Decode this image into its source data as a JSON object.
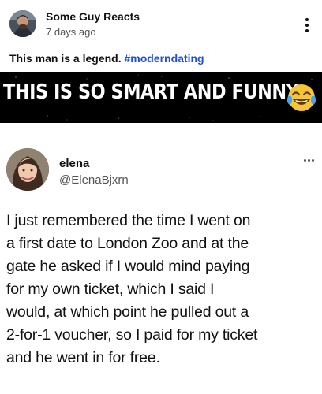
{
  "post": {
    "author": "Some Guy Reacts",
    "time": "7 days ago",
    "caption_text": "This man is a legend. ",
    "hashtag": "#moderndating",
    "banner_text": "THIS IS SO SMART AND FUNNY",
    "banner_emoji_icon": "face-with-tears-of-joy-icon"
  },
  "tweet": {
    "name": "elena",
    "handle": "@ElenaBjxrn",
    "text": "I just remembered the time I went on\na first date to London Zoo and at the\ngate he asked if I would mind paying\nfor my own ticket, which I said I\nwould, at which point he pulled out a\n2-for-1 voucher, so I paid for my ticket\nand he went in for free."
  },
  "colors": {
    "hashtag": "#1d4ed8",
    "banner_bg": "#000000",
    "banner_text": "#ffffff"
  }
}
